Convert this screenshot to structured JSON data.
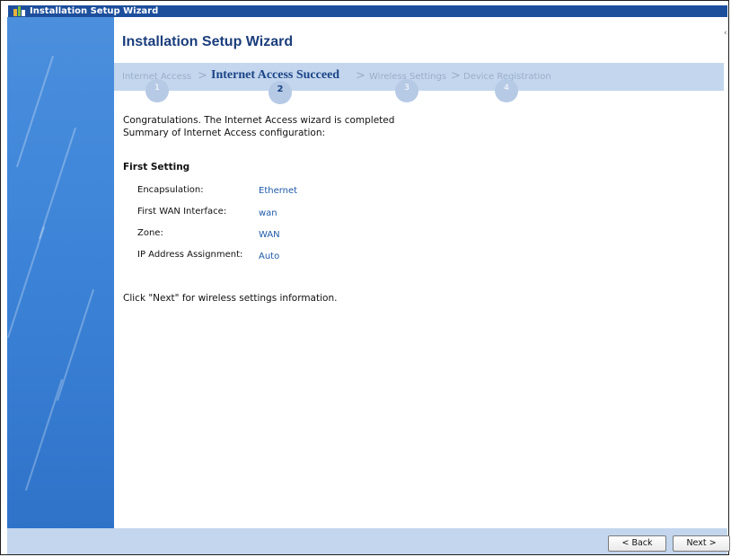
{
  "window": {
    "title": "Installation Setup Wizard",
    "icon": "wizard-icon"
  },
  "header": {
    "title": "Installation Setup Wizard"
  },
  "steps": [
    {
      "label": "Internet Access",
      "number": "1",
      "active": false
    },
    {
      "label": "Internet Access Succeed",
      "number": "2",
      "active": true
    },
    {
      "label": "Wireless Settings",
      "number": "3",
      "active": false
    },
    {
      "label": "Device Registration",
      "number": "4",
      "active": false
    }
  ],
  "step_separator": ">",
  "content": {
    "intro_line1": "Congratulations. The Internet Access wizard is completed",
    "intro_line2": "Summary of Internet Access configuration:",
    "section_title": "First Setting",
    "fields": [
      {
        "label": "Encapsulation:",
        "value": "Ethernet"
      },
      {
        "label": "First WAN Interface:",
        "value": "wan"
      },
      {
        "label": "Zone:",
        "value": "WAN"
      },
      {
        "label": "IP Address Assignment:",
        "value": "Auto"
      }
    ],
    "next_hint": "Click \"Next\" for wireless settings information."
  },
  "footer": {
    "back_label": "< Back",
    "next_label": "Next >"
  },
  "colors": {
    "titlebar": "#1c4e9c",
    "stepsbar": "#c3d6ee",
    "active_step": "#1b4486",
    "value_text": "#1f5aa8"
  }
}
